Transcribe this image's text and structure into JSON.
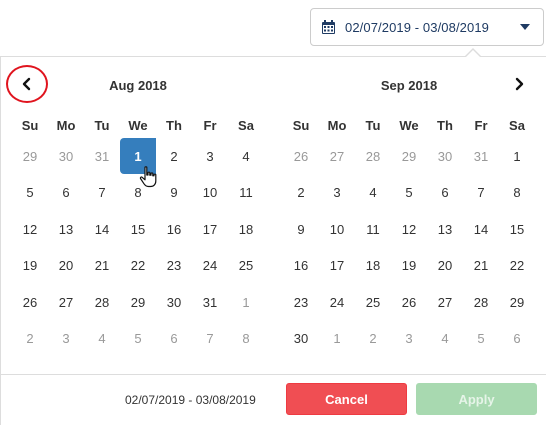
{
  "date_range": {
    "value": "02/07/2019 - 03/08/2019"
  },
  "icons": {
    "calendar": "calendar-icon",
    "caret": "caret-down-icon",
    "prev": "chevron-left-icon",
    "next": "chevron-right-icon",
    "cursor": "hand-pointer-icon"
  },
  "calendars": [
    {
      "title": "Aug 2018",
      "weekdays": [
        "Su",
        "Mo",
        "Tu",
        "We",
        "Th",
        "Fr",
        "Sa"
      ],
      "weeks": [
        [
          "29",
          "30",
          "31",
          "1",
          "2",
          "3",
          "4"
        ],
        [
          "5",
          "6",
          "7",
          "8",
          "9",
          "10",
          "11"
        ],
        [
          "12",
          "13",
          "14",
          "15",
          "16",
          "17",
          "18"
        ],
        [
          "19",
          "20",
          "21",
          "22",
          "23",
          "24",
          "25"
        ],
        [
          "26",
          "27",
          "28",
          "29",
          "30",
          "31",
          "1"
        ],
        [
          "2",
          "3",
          "4",
          "5",
          "6",
          "7",
          "8"
        ]
      ],
      "off_days": [
        [
          0,
          0
        ],
        [
          0,
          1
        ],
        [
          0,
          2
        ],
        [
          4,
          6
        ],
        [
          5,
          0
        ],
        [
          5,
          1
        ],
        [
          5,
          2
        ],
        [
          5,
          3
        ],
        [
          5,
          4
        ],
        [
          5,
          5
        ],
        [
          5,
          6
        ]
      ],
      "active_day": [
        0,
        3
      ]
    },
    {
      "title": "Sep 2018",
      "weekdays": [
        "Su",
        "Mo",
        "Tu",
        "We",
        "Th",
        "Fr",
        "Sa"
      ],
      "weeks": [
        [
          "26",
          "27",
          "28",
          "29",
          "30",
          "31",
          "1"
        ],
        [
          "2",
          "3",
          "4",
          "5",
          "6",
          "7",
          "8"
        ],
        [
          "9",
          "10",
          "11",
          "12",
          "13",
          "14",
          "15"
        ],
        [
          "16",
          "17",
          "18",
          "19",
          "20",
          "21",
          "22"
        ],
        [
          "23",
          "24",
          "25",
          "26",
          "27",
          "28",
          "29"
        ],
        [
          "30",
          "1",
          "2",
          "3",
          "4",
          "5",
          "6"
        ]
      ],
      "off_days": [
        [
          0,
          0
        ],
        [
          0,
          1
        ],
        [
          0,
          2
        ],
        [
          0,
          3
        ],
        [
          0,
          4
        ],
        [
          0,
          5
        ],
        [
          5,
          1
        ],
        [
          5,
          2
        ],
        [
          5,
          3
        ],
        [
          5,
          4
        ],
        [
          5,
          5
        ],
        [
          5,
          6
        ]
      ],
      "active_day": null
    }
  ],
  "footer": {
    "range_label": "02/07/2019 - 03/08/2019",
    "cancel_label": "Cancel",
    "apply_label": "Apply"
  },
  "colors": {
    "active_day": "#357ebd",
    "cancel": "#f04e53",
    "apply_disabled": "#a8d9b0",
    "highlight_ring": "#e0141e"
  }
}
